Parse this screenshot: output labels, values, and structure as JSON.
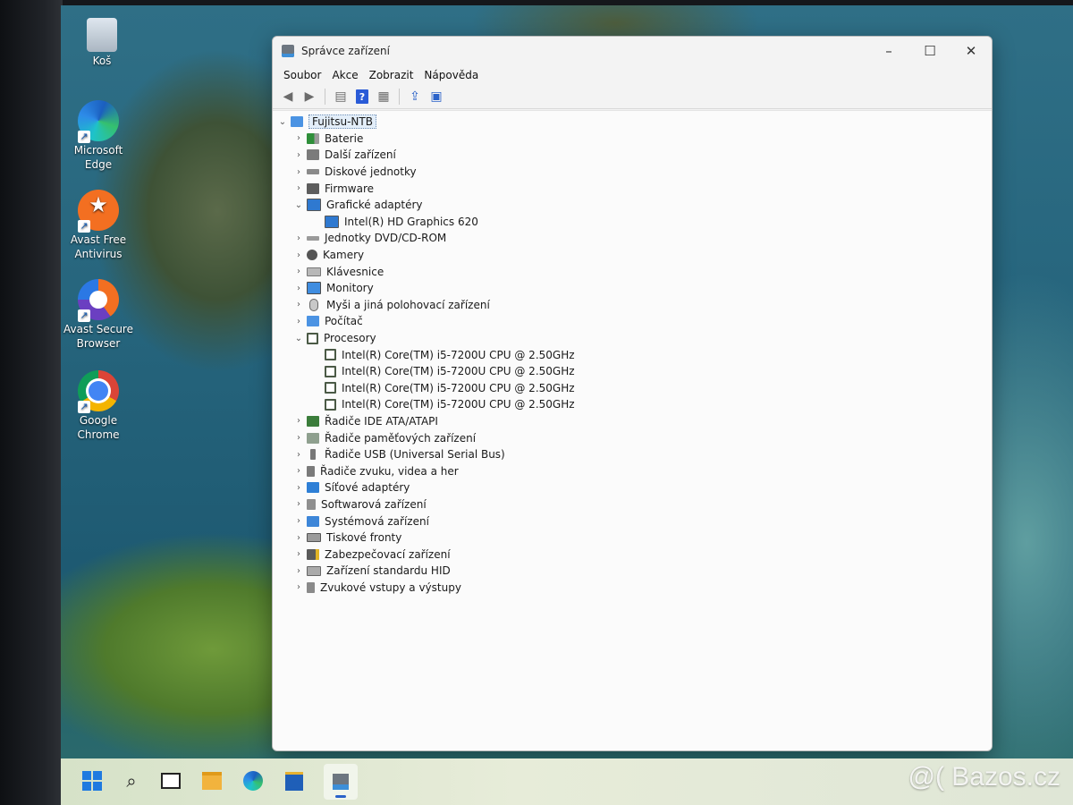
{
  "desktop": {
    "icons": [
      {
        "name": "recycle-bin",
        "label": "Koš"
      },
      {
        "name": "microsoft-edge",
        "label": "Microsoft Edge"
      },
      {
        "name": "avast-free-antivirus",
        "label": "Avast Free Antivirus"
      },
      {
        "name": "avast-secure-browser",
        "label": "Avast Secure Browser"
      },
      {
        "name": "google-chrome",
        "label": "Google Chrome"
      }
    ]
  },
  "window": {
    "title": "Správce zařízení",
    "controls": {
      "minimize": "–",
      "maximize": "☐",
      "close": "✕"
    },
    "menu": [
      "Soubor",
      "Akce",
      "Zobrazit",
      "Nápověda"
    ],
    "toolbar": {
      "back": "back-arrow",
      "forward": "forward-arrow",
      "properties": "properties-sheet",
      "help": "?",
      "view": "view-sheet",
      "update": "update-driver",
      "scan": "scan-monitor"
    }
  },
  "tree": {
    "root": "Fujitsu-NTB",
    "items": [
      {
        "label": "Baterie",
        "expanded": false
      },
      {
        "label": "Další zařízení",
        "expanded": false
      },
      {
        "label": "Diskové jednotky",
        "expanded": false
      },
      {
        "label": "Firmware",
        "expanded": false
      },
      {
        "label": "Grafické adaptéry",
        "expanded": true,
        "children": [
          "Intel(R) HD Graphics 620"
        ]
      },
      {
        "label": "Jednotky DVD/CD-ROM",
        "expanded": false
      },
      {
        "label": "Kamery",
        "expanded": false
      },
      {
        "label": "Klávesnice",
        "expanded": false
      },
      {
        "label": "Monitory",
        "expanded": false
      },
      {
        "label": "Myši a jiná polohovací zařízení",
        "expanded": false
      },
      {
        "label": "Počítač",
        "expanded": false
      },
      {
        "label": "Procesory",
        "expanded": true,
        "children": [
          "Intel(R) Core(TM) i5-7200U CPU @ 2.50GHz",
          "Intel(R) Core(TM) i5-7200U CPU @ 2.50GHz",
          "Intel(R) Core(TM) i5-7200U CPU @ 2.50GHz",
          "Intel(R) Core(TM) i5-7200U CPU @ 2.50GHz"
        ]
      },
      {
        "label": "Řadiče IDE ATA/ATAPI",
        "expanded": false
      },
      {
        "label": "Řadiče paměťových zařízení",
        "expanded": false
      },
      {
        "label": "Řadiče USB (Universal Serial Bus)",
        "expanded": false
      },
      {
        "label": "Řadiče zvuku, videa a her",
        "expanded": false
      },
      {
        "label": "Síťové adaptéry",
        "expanded": false
      },
      {
        "label": "Softwarová zařízení",
        "expanded": false
      },
      {
        "label": "Systémová zařízení",
        "expanded": false
      },
      {
        "label": "Tiskové fronty",
        "expanded": false
      },
      {
        "label": "Zabezpečovací zařízení",
        "expanded": false
      },
      {
        "label": "Zařízení standardu HID",
        "expanded": false
      },
      {
        "label": "Zvukové vstupy a výstupy",
        "expanded": false
      }
    ]
  },
  "taskbar": {
    "items": [
      "start",
      "search",
      "task-view",
      "file-explorer",
      "microsoft-edge",
      "microsoft-store",
      "device-manager"
    ],
    "active": "device-manager"
  },
  "watermark": "@( Bazos.cz"
}
